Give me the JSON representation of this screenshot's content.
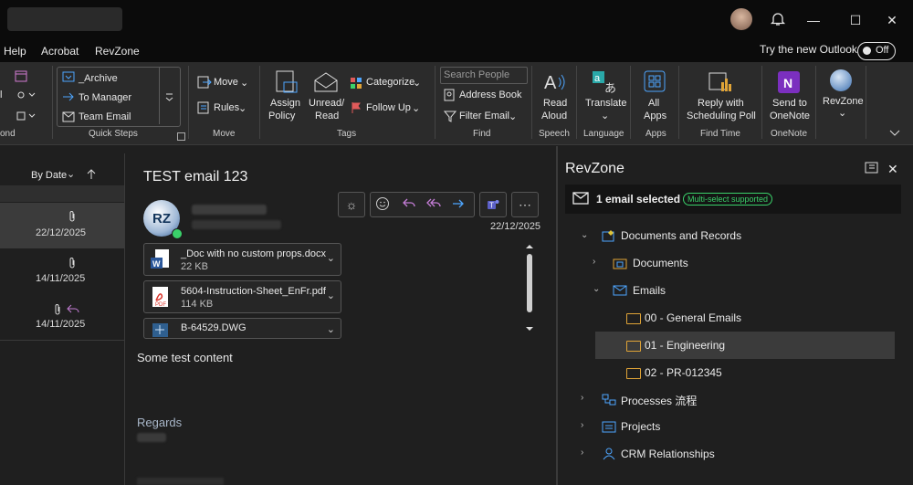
{
  "window": {
    "minimize": "—",
    "maximize": "☐",
    "close": "✕"
  },
  "menu": {
    "items": [
      "Help",
      "Acrobat",
      "RevZone"
    ],
    "try_new": "Try the new Outlook",
    "toggle": "Off"
  },
  "ribbon": {
    "frag_left": [
      "l",
      "ond"
    ],
    "quick_steps": {
      "items": [
        "_Archive",
        "To Manager",
        "Team Email"
      ],
      "group": "Quick Steps"
    },
    "move": {
      "move": "Move",
      "rules": "Rules",
      "group": "Move"
    },
    "tags": {
      "assign": "Assign",
      "policy": "Policy",
      "unread": "Unread/",
      "read": "Read",
      "categorize": "Categorize",
      "follow": "Follow Up",
      "group": "Tags"
    },
    "find": {
      "search_placeholder": "Search People",
      "address": "Address Book",
      "filter": "Filter Email",
      "group": "Find"
    },
    "speech": {
      "read": "Read",
      "aloud": "Aloud",
      "group": "Speech"
    },
    "language": {
      "translate": "Translate",
      "group": "Language"
    },
    "apps": {
      "all": "All",
      "apps": "Apps",
      "group": "Apps"
    },
    "findtime": {
      "reply": "Reply with",
      "poll": "Scheduling Poll",
      "group": "Find Time"
    },
    "onenote": {
      "send": "Send to",
      "onenote": "OneNote",
      "group": "OneNote"
    },
    "revzone": {
      "label": "RevZone"
    }
  },
  "list": {
    "sort": "By Date",
    "items": [
      {
        "date": "22/12/2025"
      },
      {
        "date": "14/11/2025"
      },
      {
        "date": "14/11/2025"
      }
    ]
  },
  "email": {
    "subject": "TEST email 123",
    "avatar": "RZ",
    "date": "22/12/2025",
    "attachments": [
      {
        "name": "_Doc with no custom props.docx",
        "size": "22 KB",
        "icon": "word-icon"
      },
      {
        "name": "5604-Instruction-Sheet_EnFr.pdf",
        "size": "114 KB",
        "icon": "pdf-icon"
      },
      {
        "name": "B-64529.DWG",
        "size": "",
        "icon": "dwg-icon"
      }
    ],
    "body": "Some test content",
    "regards": "Regards"
  },
  "revzone": {
    "title": "RevZone",
    "selected": "1 email selected",
    "badge": "Multi-select supported",
    "tree": [
      {
        "label": "Documents and Records"
      },
      {
        "label": "Documents"
      },
      {
        "label": "Emails"
      },
      {
        "label": "00 - General Emails"
      },
      {
        "label": "01 - Engineering"
      },
      {
        "label": "02 - PR-012345"
      },
      {
        "label": "Processes 流程"
      },
      {
        "label": "Projects"
      },
      {
        "label": "CRM Relationships"
      }
    ]
  },
  "colors": {
    "accent": "#4ea6ff",
    "badge": "#3ad16a",
    "folder": "#e0a437"
  }
}
